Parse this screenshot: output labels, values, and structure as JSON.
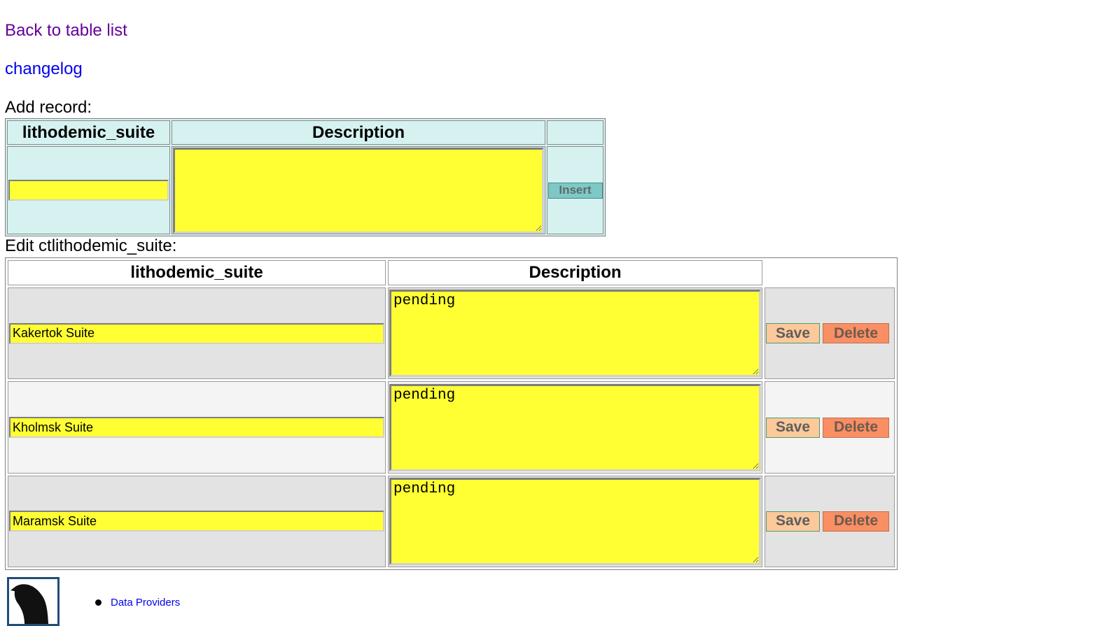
{
  "nav": {
    "back_label": "Back to table list",
    "changelog_label": "changelog"
  },
  "add_record": {
    "title": "Add record:",
    "col_suite": "lithodemic_suite",
    "col_description": "Description",
    "suite_value": "",
    "description_value": "",
    "insert_label": "Insert"
  },
  "edit": {
    "title": "Edit ctlithodemic_suite:",
    "col_suite": "lithodemic_suite",
    "col_description": "Description",
    "save_label": "Save",
    "delete_label": "Delete",
    "rows": [
      {
        "suite": "Kakertok Suite",
        "description": "pending"
      },
      {
        "suite": "Kholmsk Suite",
        "description": "pending"
      },
      {
        "suite": "Maramsk Suite",
        "description": "pending"
      }
    ]
  },
  "footer": {
    "links": [
      "Data Providers"
    ]
  },
  "colors": {
    "input_bg": "#ffff33",
    "add_table_bg": "#d5f2f0",
    "save_bg": "#fdc99a",
    "delete_bg": "#f98f63",
    "insert_bg": "#7fc8c6",
    "visited_link": "#660099",
    "link": "#0000ee"
  }
}
